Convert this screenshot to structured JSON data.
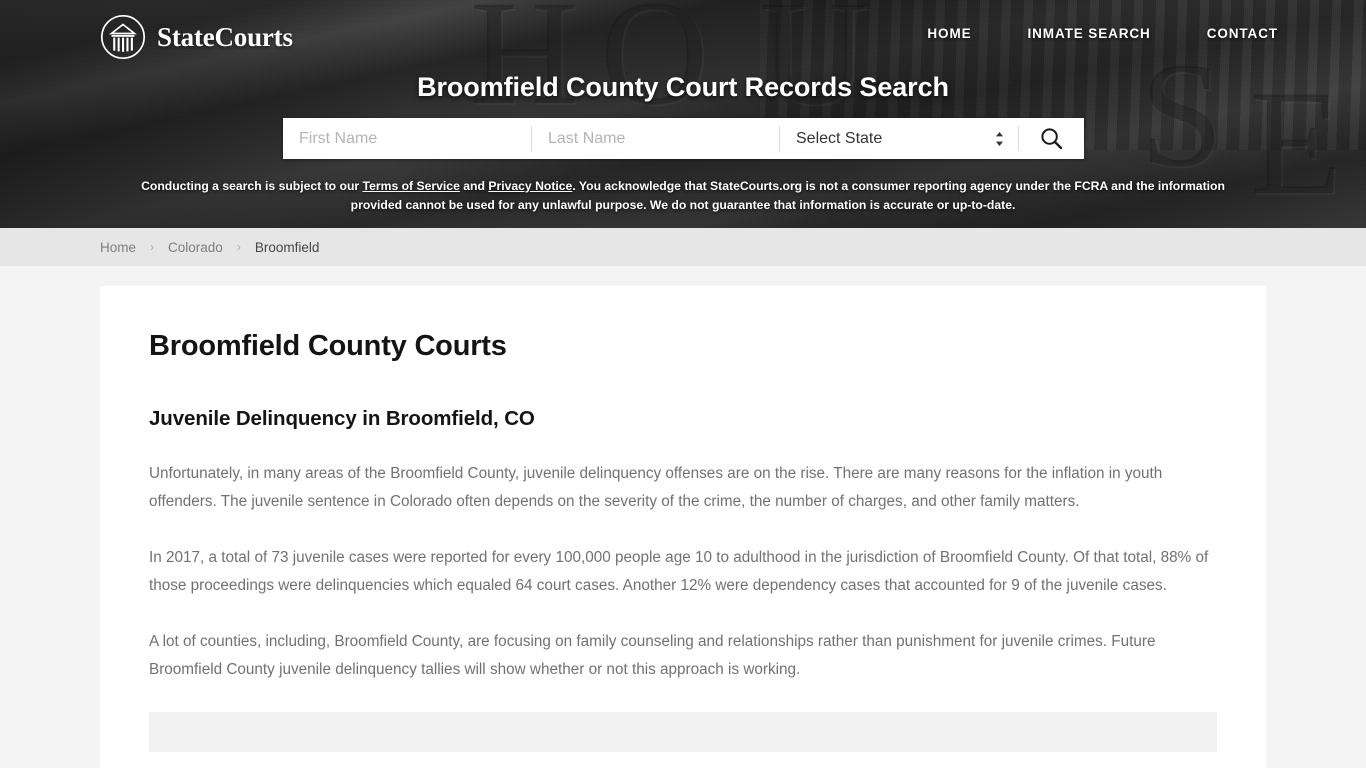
{
  "header": {
    "logo_text": "StateCourts",
    "logo_icon": "courthouse-icon",
    "nav": [
      {
        "label": "HOME"
      },
      {
        "label": "INMATE SEARCH"
      },
      {
        "label": "CONTACT"
      }
    ],
    "title": "Broomfield County Court Records Search",
    "background_letters": "HOUSE"
  },
  "search": {
    "first_name_value": "",
    "first_name_placeholder": "First Name",
    "last_name_value": "",
    "last_name_placeholder": "Last Name",
    "state_selected": "Select State",
    "state_options": [
      "Select State"
    ],
    "search_icon": "magnifier-icon",
    "stepper_icon": "chevron-up-down-icon"
  },
  "disclaimer": {
    "part1": "Conducting a search is subject to our ",
    "link1": "Terms of Service",
    "part2": " and ",
    "link2": "Privacy Notice",
    "part3": ". You acknowledge that StateCourts.org is not a consumer reporting agency under the FCRA and the information provided cannot be used for any unlawful purpose. We do not guarantee that information is accurate or up-to-date."
  },
  "breadcrumb": {
    "items": [
      {
        "label": "Home",
        "current": false
      },
      {
        "label": "Colorado",
        "current": false
      },
      {
        "label": "Broomfield",
        "current": true
      }
    ],
    "separator": "›"
  },
  "main": {
    "page_title": "Broomfield County Courts",
    "section_title": "Juvenile Delinquency in Broomfield, CO",
    "paragraphs": [
      "Unfortunately, in many areas of the Broomfield County, juvenile delinquency offenses are on the rise. There are many reasons for the inflation in youth offenders. The juvenile sentence in Colorado often depends on the severity of the crime, the number of charges, and other family matters.",
      "In 2017, a total of 73 juvenile cases were reported for every 100,000 people age 10 to adulthood in the jurisdiction of Broomfield County. Of that total, 88% of those proceedings were delinquencies which equaled 64 court cases. Another 12% were dependency cases that accounted for 9 of the juvenile cases.",
      "A lot of counties, including, Broomfield County, are focusing on family counseling and relationships rather than punishment for juvenile crimes. Future Broomfield County juvenile delinquency tallies will show whether or not this approach is working."
    ]
  },
  "colors": {
    "hero_overlay": "#2b2b2b",
    "page_bg": "#f4f4f4",
    "card_bg": "#ffffff",
    "breadcrumb_bg": "#e6e6e6",
    "body_text": "#6f7275",
    "heading_text": "#141414"
  }
}
